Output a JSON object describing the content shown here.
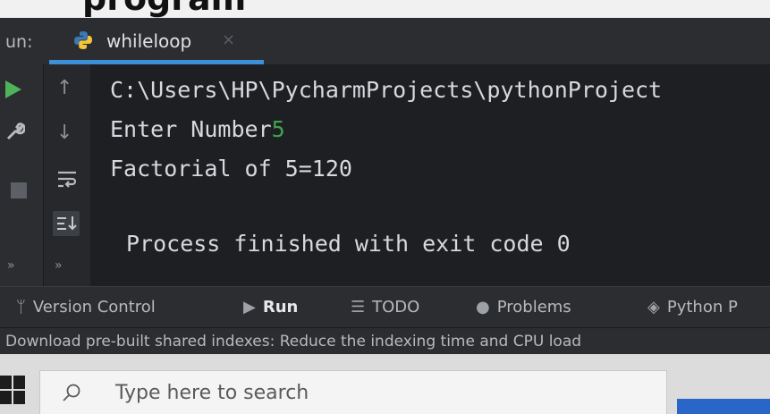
{
  "banner": {
    "text": "program"
  },
  "run_panel": {
    "label": "un:",
    "tab_name": "whileloop",
    "tab_close": "×",
    "tab_icon": "python-icon"
  },
  "toolbar": {
    "icons": [
      "rerun-icon",
      "up-arrow-icon",
      "wrench-icon",
      "down-arrow-icon",
      "stop-icon",
      "soft-wrap-icon",
      "scroll-to-end-icon",
      "more-icon"
    ]
  },
  "console": {
    "lines": [
      "C:\\Users\\HP\\PycharmProjects\\pythonProject",
      "Enter Number",
      "Factorial of 5=120",
      "Process finished with exit code 0"
    ],
    "input_value": "5"
  },
  "bottom_bar": {
    "version_control": "Version Control",
    "run": "Run",
    "todo": "TODO",
    "problems": "Problems",
    "python_packages": "Python P"
  },
  "status_bar": {
    "message": "Download pre-built shared indexes: Reduce the indexing time and CPU load"
  },
  "taskbar": {
    "search_placeholder": "Type here to search"
  },
  "colors": {
    "accent": "#3d8fd8",
    "console_bg": "#1e1f22",
    "panel_bg": "#2b2d30",
    "input_green": "#3fa34d"
  }
}
